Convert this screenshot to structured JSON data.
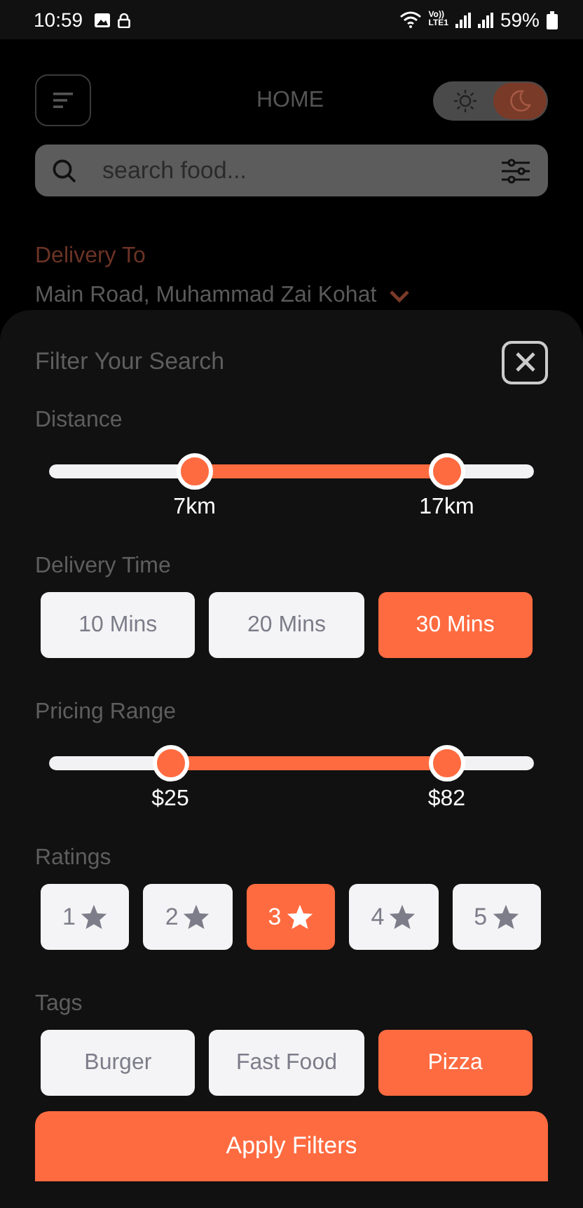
{
  "status_bar": {
    "time": "10:59",
    "network_top": "Vo))",
    "network_bottom": "LTE1",
    "battery": "59%"
  },
  "header": {
    "title": "HOME",
    "dark_mode": true
  },
  "search": {
    "placeholder": "search food..."
  },
  "delivery": {
    "label": "Delivery To",
    "address": "Main Road, Muhammad Zai Kohat"
  },
  "filter": {
    "title": "Filter Your Search",
    "distance": {
      "label": "Distance",
      "thumbs": [
        {
          "level": 0.3,
          "reading": "7km"
        },
        {
          "level": 0.82,
          "reading": "17km"
        }
      ]
    },
    "delivery_time": {
      "label": "Delivery Time",
      "options": [
        {
          "label": "10 Mins",
          "selected": false
        },
        {
          "label": "20 Mins",
          "selected": false
        },
        {
          "label": "30 Mins",
          "selected": true
        }
      ]
    },
    "pricing": {
      "label": "Pricing Range",
      "thumbs": [
        {
          "level": 0.25,
          "reading": "$25"
        },
        {
          "level": 0.82,
          "reading": "$82"
        }
      ]
    },
    "ratings": {
      "label": "Ratings",
      "options": [
        {
          "label": "1",
          "selected": false
        },
        {
          "label": "2",
          "selected": false
        },
        {
          "label": "3",
          "selected": true
        },
        {
          "label": "4",
          "selected": false
        },
        {
          "label": "5",
          "selected": false
        }
      ]
    },
    "tags": {
      "label": "Tags",
      "options": [
        {
          "label": "Burger",
          "selected": false
        },
        {
          "label": "Fast Food",
          "selected": false
        },
        {
          "label": "Pizza",
          "selected": true
        }
      ]
    },
    "apply_button": "Apply Filters"
  }
}
